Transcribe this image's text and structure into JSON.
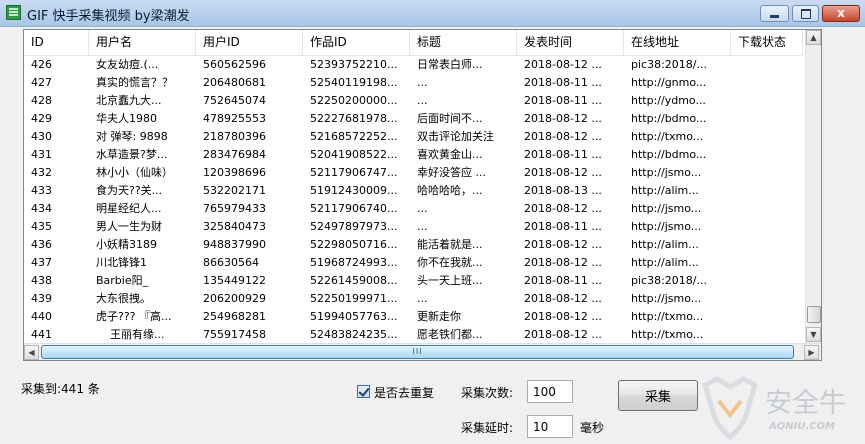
{
  "window": {
    "title": "GIF 快手采集视频 by梁潮发",
    "close_glyph": "x"
  },
  "table": {
    "columns": [
      "ID",
      "用户名",
      "用户ID",
      "作品ID",
      "标题",
      "发表时间",
      "在线地址",
      "下载状态"
    ],
    "rows": [
      [
        "426",
        "女友幼痘.(...",
        "560562596",
        "52393752210...",
        "日常表白师...",
        "2018-08-12 ...",
        "pic38:2018/...",
        ""
      ],
      [
        "427",
        "真实的慌言？？",
        "206480681",
        "52540119198...",
        "...",
        "2018-08-11 ...",
        "http://gnmo...",
        ""
      ],
      [
        "428",
        "北京蠢九大...",
        "752645074",
        "52250200000...",
        "...",
        "2018-08-11 ...",
        "http://ydmo...",
        ""
      ],
      [
        "429",
        "华夫人1980",
        "478925553",
        "52227681978...",
        "后面时间不...",
        "2018-08-12 ...",
        "http://bdmo...",
        ""
      ],
      [
        "430",
        "对  弹琴: 9898",
        "218780396",
        "52168572252...",
        "双击评论加关注",
        "2018-08-12 ...",
        "http://txmo...",
        ""
      ],
      [
        "431",
        "水草造景?梦...",
        "283476984",
        "52041908522...",
        "喜欢黄金山...",
        "2018-08-11 ...",
        "http://bdmo...",
        ""
      ],
      [
        "432",
        "林小小（仙味）",
        "120398696",
        "52117906747...",
        "幸好没答应 ...",
        "2018-08-12 ...",
        "http://jsmo...",
        ""
      ],
      [
        "433",
        "食为天??关...",
        "532202171",
        "51912430009...",
        "哈哈哈哈，...",
        "2018-08-13 ...",
        "http://alim...",
        ""
      ],
      [
        "434",
        "明星经纪人...",
        "765979433",
        "52117906740...",
        "...",
        "2018-08-12 ...",
        "http://jsmo...",
        ""
      ],
      [
        "435",
        "男人一生为财",
        "325840473",
        "52497897973...",
        "...",
        "2018-08-11 ...",
        "http://jsmo...",
        ""
      ],
      [
        "436",
        "小妖精3189",
        "948837990",
        "52298050716...",
        "能活着就是...",
        "2018-08-12 ...",
        "http://alim...",
        ""
      ],
      [
        "437",
        "川北锋锋1",
        "86630564",
        "51968724993...",
        "你不在我就...",
        "2018-08-12 ...",
        "http://alim...",
        ""
      ],
      [
        "438",
        "Barbie阳_",
        "135449122",
        "52261459008...",
        "头一天上班...",
        "2018-08-11 ...",
        "pic38:2018/...",
        ""
      ],
      [
        "439",
        "大东很拽。",
        "206200929",
        "52250199971...",
        "...",
        "2018-08-12 ...",
        "http://jsmo...",
        ""
      ],
      [
        "440",
        "虎子??? 『高...",
        "254968281",
        "51994057763...",
        "更新走你",
        "2018-08-12 ...",
        "http://txmo...",
        ""
      ],
      [
        "441",
        "王丽有缘...",
        "755917458",
        "52483824235...",
        "愿老铁们都...",
        "2018-08-12 ...",
        "http://txmo...",
        ""
      ]
    ],
    "scroll_up_glyph": "▲",
    "scroll_down_glyph": "▼",
    "scroll_left_glyph": "◀",
    "scroll_right_glyph": "▶",
    "hscroll_grip": "III"
  },
  "status": {
    "collected_label": "采集到:441 条"
  },
  "options": {
    "dedupe_label": "是否去重复",
    "dedupe_checked": true,
    "count_label": "采集次数:",
    "count_value": "100",
    "delay_label": "采集延时:",
    "delay_value": "10",
    "delay_unit": "毫秒",
    "collect_button": "采集"
  },
  "watermark": {
    "text": "安全牛",
    "sub": "AQNIU.COM"
  },
  "colors": {
    "accent": "#3c7fb1",
    "title_bar": "#b9d1ee",
    "close_button": "#c8432a"
  }
}
